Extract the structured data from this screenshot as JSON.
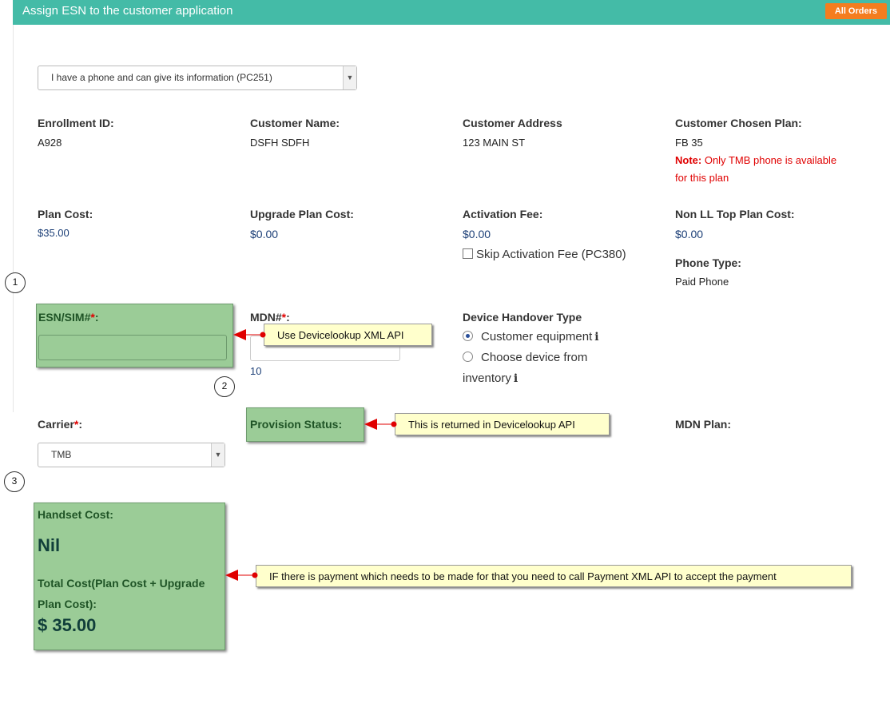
{
  "header": {
    "title": "Assign ESN to the customer application",
    "all_orders_label": "All Orders"
  },
  "phone_select": {
    "selected": "I have a phone and can give its information (PC251)"
  },
  "info": {
    "enrollment_id_label": "Enrollment ID:",
    "enrollment_id": "A928",
    "customer_name_label": "Customer Name:",
    "customer_name": "DSFH SDFH",
    "customer_address_label": "Customer Address",
    "customer_address": "123 MAIN ST",
    "chosen_plan_label": "Customer Chosen Plan:",
    "chosen_plan": "FB 35",
    "note_prefix": "Note:",
    "note_line1": " Only TMB phone is available",
    "note_line2": "for this plan"
  },
  "costs": {
    "plan_cost_label": "Plan Cost:",
    "plan_cost": "$35.00",
    "upgrade_plan_cost_label": "Upgrade Plan Cost:",
    "upgrade_plan_cost": "$0.00",
    "activation_fee_label": "Activation Fee:",
    "activation_fee": "$0.00",
    "skip_activation_label": "Skip Activation Fee (PC380)",
    "non_ll_label": "Non LL Top Plan Cost:",
    "non_ll": "$0.00",
    "phone_type_label": "Phone Type:",
    "phone_type": "Paid Phone"
  },
  "device": {
    "esn_label": "ESN/SIM#",
    "mdn_label": "MDN#",
    "required_mark": "*",
    "colon": ":",
    "mdn_count": "10",
    "handover_label": "Device Handover Type",
    "option_customer": "Customer equipment",
    "option_inventory_line1": "Choose device from",
    "option_inventory_line2": "inventory",
    "info_glyph": "i"
  },
  "carrier": {
    "label": "Carrier",
    "selected": "TMB",
    "provision_status_label": "Provision Status:",
    "mdn_plan_label": "MDN Plan:"
  },
  "totals": {
    "handset_cost_label": "Handset Cost:",
    "handset_cost": "Nil",
    "total_cost_label_line1": "Total Cost(Plan Cost + Upgrade",
    "total_cost_label_line2": "Plan Cost):",
    "total_cost": "$ 35.00"
  },
  "annotations": {
    "callout_1": "Use Devicelookup XML API",
    "callout_2": "This is returned in Devicelookup API",
    "callout_3": "IF there is payment which needs to be made for that you need to call Payment XML API to accept the payment",
    "step_1": "1",
    "step_2": "2",
    "step_3": "3"
  },
  "colors": {
    "header": "#44bba7",
    "all_orders": "#f47d1f",
    "highlight": "#9bcc97",
    "callout": "#ffffcc",
    "arrow": "#e00000"
  }
}
